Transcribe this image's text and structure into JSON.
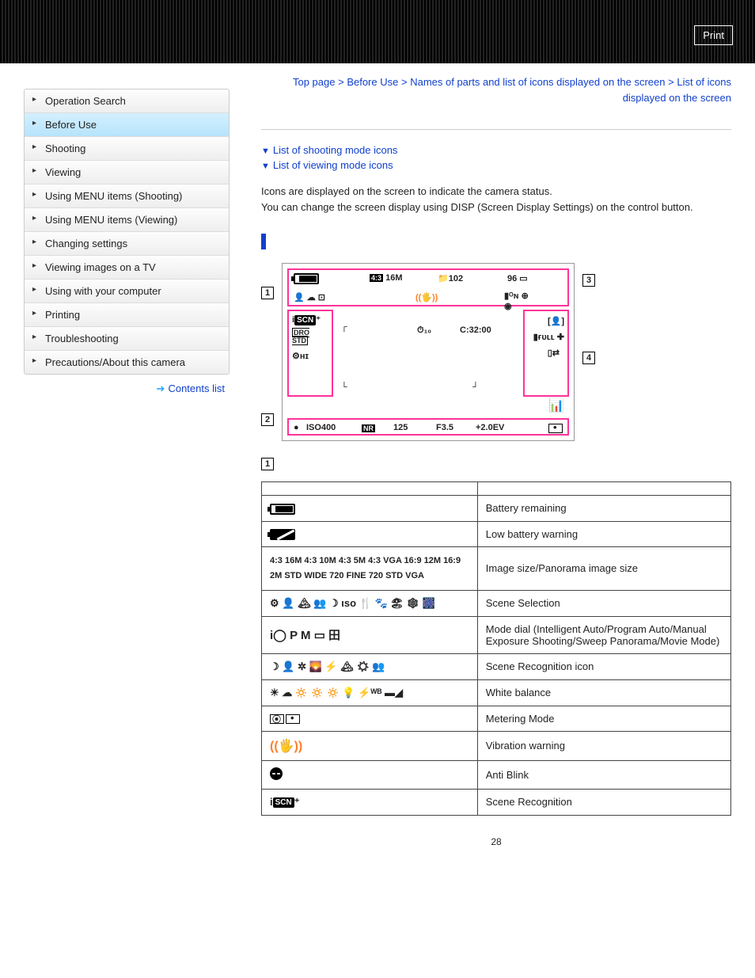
{
  "header": {
    "print_label": "Print"
  },
  "breadcrumb": {
    "top": "Top page",
    "before_use": "Before Use",
    "names": "Names of parts and list of icons displayed on the screen",
    "current": "List of icons displayed on the screen"
  },
  "sidebar": {
    "items": [
      {
        "label": "Operation Search",
        "active": false
      },
      {
        "label": "Before Use",
        "active": true
      },
      {
        "label": "Shooting",
        "active": false
      },
      {
        "label": "Viewing",
        "active": false
      },
      {
        "label": "Using MENU items (Shooting)",
        "active": false
      },
      {
        "label": "Using MENU items (Viewing)",
        "active": false
      },
      {
        "label": "Changing settings",
        "active": false
      },
      {
        "label": "Viewing images on a TV",
        "active": false
      },
      {
        "label": "Using with your computer",
        "active": false
      },
      {
        "label": "Printing",
        "active": false
      },
      {
        "label": "Troubleshooting",
        "active": false
      },
      {
        "label": "Precautions/About this camera",
        "active": false
      }
    ],
    "contents_list": "Contents list"
  },
  "anchors": {
    "shooting": "List of shooting mode icons",
    "viewing": "List of viewing mode icons"
  },
  "intro": {
    "line1": "Icons are displayed on the screen to indicate the camera status.",
    "line2": "You can change the screen display using DISP (Screen Display Settings) on the control button."
  },
  "diagram": {
    "top_row": {
      "size": "4:3 16M",
      "folder": "102",
      "remaining": "96"
    },
    "mid_row": {
      "timer": "10",
      "code": "C:32:00"
    },
    "bottom_row": {
      "rec": "●",
      "iso": "ISO400",
      "nr": "NR",
      "shutter": "125",
      "fnum": "F3.5",
      "ev": "+2.0EV"
    },
    "callouts": {
      "c1": "1",
      "c2": "2",
      "c3": "3",
      "c4": "4"
    }
  },
  "region_label": "1",
  "table": {
    "headers": {
      "display": "",
      "indication": ""
    },
    "rows": [
      {
        "desc": "Battery remaining"
      },
      {
        "desc": "Low battery warning"
      },
      {
        "icons_text": "4:3 16M 4:3 10M 4:3 5M 4:3 VGA 16:9 12M 16:9 2M STD WIDE 720 FINE 720 STD VGA",
        "desc": "Image size/Panorama image size"
      },
      {
        "desc": "Scene Selection"
      },
      {
        "icons_text": "i◯ P M ▭ 田",
        "desc": "Mode dial (Intelligent Auto/Program Auto/Manual Exposure Shooting/Sweep Panorama/Movie Mode)"
      },
      {
        "desc": "Scene Recognition icon"
      },
      {
        "desc": "White balance"
      },
      {
        "desc": "Metering Mode"
      },
      {
        "desc": "Vibration warning"
      },
      {
        "desc": "Anti Blink"
      },
      {
        "icons_text": "iSCN⁺",
        "desc": "Scene Recognition"
      }
    ]
  },
  "page_number": "28"
}
